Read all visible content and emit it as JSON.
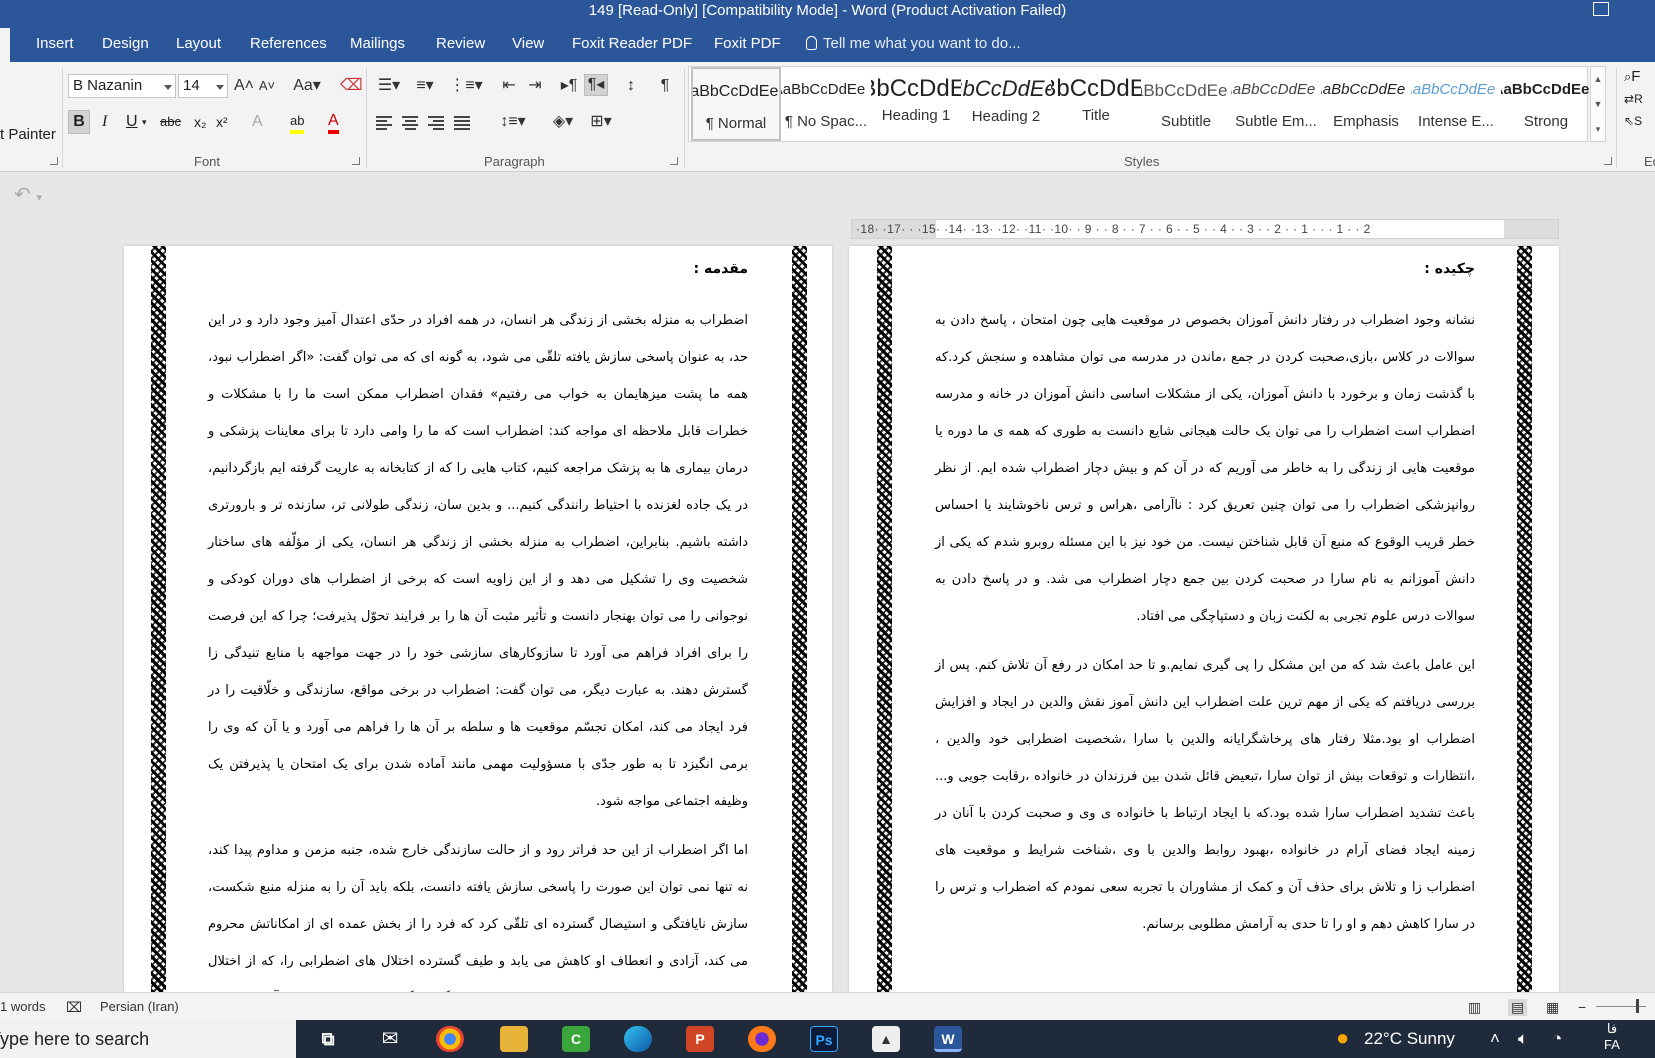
{
  "window": {
    "title": "149 [Read-Only] [Compatibility Mode] - Word (Product Activation Failed)"
  },
  "tabs": [
    "Insert",
    "Design",
    "Layout",
    "References",
    "Mailings",
    "Review",
    "View",
    "Foxit Reader PDF",
    "Foxit PDF"
  ],
  "tell_me": "Tell me what you want to do...",
  "clipboard": {
    "format_painter": "t Painter"
  },
  "font": {
    "name": "B Nazanin",
    "size": "14",
    "group_label": "Font"
  },
  "paragraph": {
    "group_label": "Paragraph"
  },
  "styles": {
    "group_label": "Styles",
    "items": [
      {
        "sample": "AaBbCcDdEe",
        "name": "¶ Normal"
      },
      {
        "sample": "AaBbCcDdEe",
        "name": "¶ No Spac..."
      },
      {
        "sample": "AaBbCcDdEe",
        "name": "Heading 1"
      },
      {
        "sample": "AaBbCcDdEe",
        "name": "Heading 2"
      },
      {
        "sample": "AaBbCcDdEe",
        "name": "Title"
      },
      {
        "sample": "AaBbCcDdEe",
        "name": "Subtitle"
      },
      {
        "sample": "AaBbCcDdEe",
        "name": "Subtle Em..."
      },
      {
        "sample": "AaBbCcDdEe",
        "name": "Emphasis"
      },
      {
        "sample": "AaBbCcDdEe",
        "name": "Intense E..."
      },
      {
        "sample": "AaBbCcDdEe",
        "name": "Strong"
      }
    ]
  },
  "editing": {
    "items": [
      "F",
      "R",
      "S"
    ],
    "group_label": "Ed"
  },
  "ruler": {
    "numbers": "·18· ·17· · ·15· ·14· ·13· ·12· ·11· ·10· · 9 · · 8 · · 7 · · 6 · · 5 · · 4 · · 3 · · 2 · · 1 · · · 1 · · 2"
  },
  "pages": {
    "left": {
      "heading": "مقدمه :",
      "paragraphs": [
        "اضطراب به منزله بخشی از زندگی هر انسان، در همه افراد در حدّی اعتدال آمیز وجود دارد و در این حد، به عنوان پاسخی سازش یافته تلقّی می شود، به گونه ای که می توان گفت: «اگر اضطراب نبود، همه ما پشت میزهایمان به خواب می رفتیم» فقدان اضطراب ممکن است ما را با مشکلات و خطرات قابل ملاحظه ای مواجه کند: اضطراب است که ما را وامی دارد تا برای معاینات پزشکی و درمان بیماری ها به پزشک مراجعه کنیم، کتاب هایی را که از کتابخانه به عاریت گرفته ایم بازگردانیم، در یک جاده لغزنده با احتیاط رانندگی کنیم... و بدین سان، زندگی طولانی تر، سازنده تر و بارورتری داشته باشیم. بنابراین، اضطراب به منزله بخشی از زندگی هر انسان، یکی از مؤلّفه های ساختار شخصیت وی را تشکیل می دهد و از این زاویه است که برخی از اضطراب های دوران کودکی و نوجوانی را می توان بهنجار دانست و تأثیر مثبت آن ها را بر فرایند تحوّل پذیرفت؛ چرا که این فرصت را برای افراد فراهم می آورد تا سازوکارهای سازشی خود را در جهت مواجهه با منابع تنیدگی زا گسترش دهند. به عبارت دیگر، می توان گفت: اضطراب در برخی مواقع، سازندگی و خلّاقیت را در فرد ایجاد می کند، امکان تجسّم موقعیت ها و سلطه بر آن ها را فراهم می آورد و یا آن که وی را برمی انگیزد تا به طور جدّی با مسؤولیت مهمی مانند آماده شدن برای یک امتحان یا پذیرفتن یک وظیفه اجتماعی مواجه شود.",
        "اما اگر اضطراب از این حد فراتر رود و از حالت سازندگی خارج شده، جنبه مزمن و مداوم پیدا کند، نه تنها نمی توان این صورت را پاسخی سازش یافته دانست، بلکه باید آن را به منزله منبع شکست، سازش نایافتگی و استیصال گسترده ای تلقّی کرد که فرد را از بخش عمده ای از امکاناتش محروم می کند، آزادی و انعطاف او کاهش می یابد و طیف گسترده اختلال های اضطرابی را، که از اختلال های شناختی و بدنی تا ترس های غیر موجّه و وحشت زدگی ها گسترده اند، به وجود می آورد."
      ]
    },
    "right": {
      "heading": "چکیده :",
      "paragraphs": [
        "نشانه وجود اضطراب در رفتار دانش آموزان بخصوص در موقعیت هایی چون امتحان ، پاسخ دادن به سوالات در کلاس ،بازی،صحبت کردن در جمع ،ماندن در مدرسه می توان مشاهده و سنجش کرد.که با گذشت زمان و برخورد با دانش آموزان، یکی از مشکلات  اساسی دانش آموزان در خانه و مدرسه اضطراب است اضطراب را می توان یک حالت هیجانی شایع دانست به طوری که همه ی ما دوره یا موقعیت هایی از زندگی را به خاطر می آوریم که در آن کم و بیش دچار اضطراب شده ایم. از نظر روانپزشکی اضطراب را می توان چنین تعریق کرد : ناآرامی ،هراس و ترس ناخوشایند یا احساس خطر قریب الوقوع که منبع آن قابل شناختن نیست. من خود نیز با این مسئله روبرو شدم که یکی از دانش آموزانم به نام سارا در صحبت کردن بین جمع دچار اضطراب می شد. و در پاسخ دادن به سوالات درس علوم تجربی به لکنت زبان و دستپاچگی می افتاد.",
        "این عامل باعث شد که من این مشکل را پی گیری نمایم.و تا حد امکان در رفع آن تلاش کنم. پس از بررسی دریافتم که یکی از مهم ترین علت اضطراب این دانش آموز نقش والدین در ایجاد و افزایش اضطراب او بود.مثلا رفتار های پرخاشگرایانه والدین با سارا ،شخصیت اضطرابی خود والدین ، ،انتظارات و توقعات بیش از توان سارا ،تبعیض قائل شدن بین فرزندان در خانواده ،رقابت جویی و... باعث تشدید اضطراب سارا شده بود.که با ایجاد ارتباط با خانواده ی وی و صحبت کردن با آنان در زمینه ایجاد فضای آرام در خانواده ،بهبود روابط والدین با وی ،شناخت شرایط و موقعیت های اضطراب زا و تلاش برای حذف آن و کمک از مشاوران با تجربه سعی نمودم که اضطراب و ترس را در سارا کاهش دهم و او را تا حدی به آرامش مطلوبی برسانم."
      ]
    }
  },
  "status": {
    "words": "1 words",
    "language": "Persian (Iran)"
  },
  "taskbar": {
    "search": "Type here to search",
    "weather": "22°C  Sunny",
    "lang_top": "فا",
    "lang_bottom": "FA"
  }
}
